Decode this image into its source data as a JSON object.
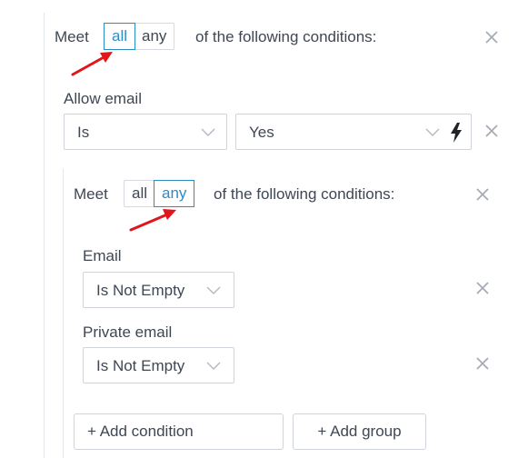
{
  "top_group": {
    "meet_label": "Meet",
    "match_options": [
      "all",
      "any"
    ],
    "selected_match": "all",
    "suffix": "of the following conditions:"
  },
  "allow_email": {
    "label": "Allow email",
    "operator": "Is",
    "value": "Yes"
  },
  "nested_group": {
    "meet_label": "Meet",
    "match_options": [
      "all",
      "any"
    ],
    "selected_match": "any",
    "suffix": "of the following conditions:",
    "conditions": [
      {
        "label": "Email",
        "operator": "Is Not Empty"
      },
      {
        "label": "Private email",
        "operator": "Is Not Empty"
      }
    ],
    "add_condition_label": "+ Add condition",
    "add_group_label": "+ Add group"
  },
  "colors": {
    "accent": "#2e8cc4",
    "annotation_arrow": "#e0161b",
    "text": "#3f4654",
    "border": "#cfd4db"
  }
}
